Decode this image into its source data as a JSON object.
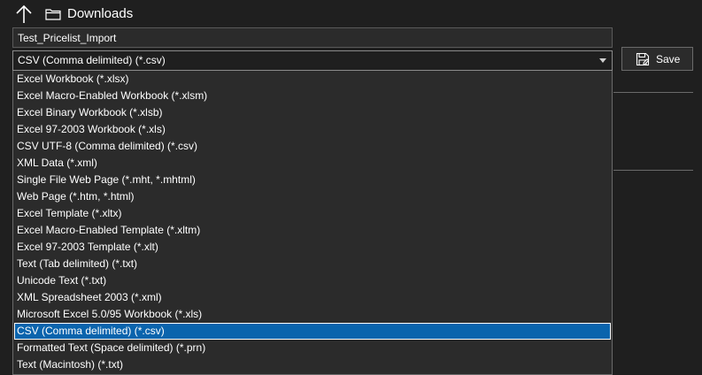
{
  "location": {
    "label": "Downloads"
  },
  "filename": {
    "value": "Test_Pricelist_Import"
  },
  "filetype": {
    "selected": "CSV (Comma delimited) (*.csv)"
  },
  "save_button": {
    "label": "Save"
  },
  "options": [
    "Excel Workbook (*.xlsx)",
    "Excel Macro-Enabled Workbook (*.xlsm)",
    "Excel Binary Workbook (*.xlsb)",
    "Excel 97-2003 Workbook (*.xls)",
    "CSV UTF-8 (Comma delimited) (*.csv)",
    "XML Data (*.xml)",
    "Single File Web Page (*.mht, *.mhtml)",
    "Web Page (*.htm, *.html)",
    "Excel Template (*.xltx)",
    "Excel Macro-Enabled Template (*.xltm)",
    "Excel 97-2003 Template (*.xlt)",
    "Text (Tab delimited) (*.txt)",
    "Unicode Text (*.txt)",
    "XML Spreadsheet 2003 (*.xml)",
    "Microsoft Excel 5.0/95 Workbook (*.xls)",
    "CSV (Comma delimited) (*.csv)",
    "Formatted Text (Space delimited) (*.prn)",
    "Text (Macintosh) (*.txt)"
  ],
  "selected_index": 15,
  "colors": {
    "background": "#1f1f1f",
    "selected": "#0a64ad",
    "border": "#6a6a6a"
  },
  "icons": {
    "up": "up-arrow-icon",
    "folder": "folder-icon",
    "save": "save-icon",
    "dropdown": "chevron-down-icon"
  }
}
